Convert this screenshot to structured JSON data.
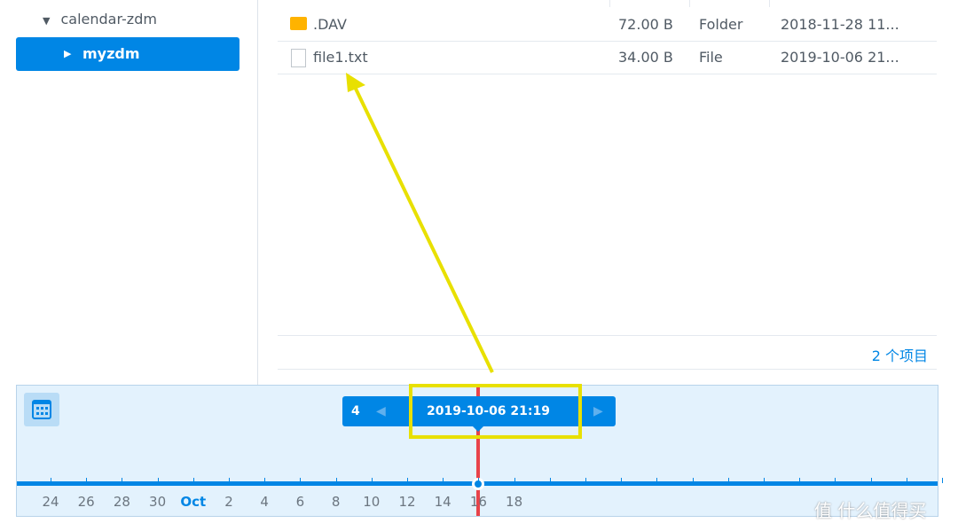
{
  "tree": {
    "parent": "calendar-zdm",
    "selected": "myzdm"
  },
  "files": [
    {
      "name": ".DAV",
      "size": "72.00 B",
      "type": "Folder",
      "modified": "2018-11-28 11...",
      "icon": "folder-icon"
    },
    {
      "name": "file1.txt",
      "size": "34.00 B",
      "type": "File",
      "modified": "2019-10-06 21...",
      "icon": "file-icon"
    }
  ],
  "footer": {
    "count": "2 个项目"
  },
  "timeline": {
    "version_count": "4",
    "current": "2019-10-06 21:19",
    "labels": [
      "24",
      "26",
      "28",
      "30",
      "Oct",
      "2",
      "4",
      "6",
      "8",
      "10",
      "12",
      "14",
      "16",
      "18"
    ],
    "accent": "#0086e5",
    "marker_color": "#e8434a"
  },
  "watermark": "值 什么值得买"
}
